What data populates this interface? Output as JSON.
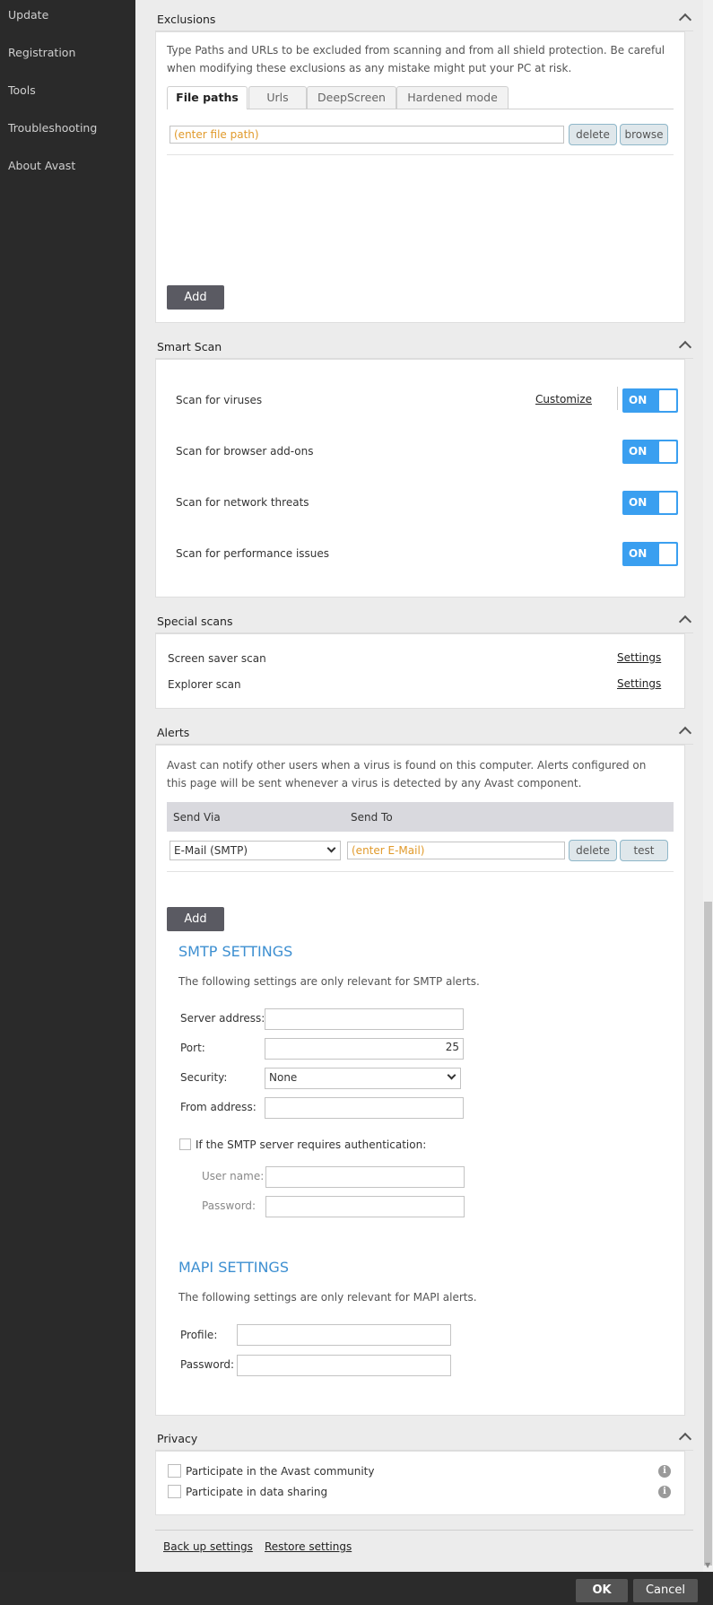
{
  "sidebar": {
    "items": [
      {
        "label": "Update"
      },
      {
        "label": "Registration"
      },
      {
        "label": "Tools"
      },
      {
        "label": "Troubleshooting"
      },
      {
        "label": "About Avast"
      }
    ]
  },
  "exclusions": {
    "title": "Exclusions",
    "description": "Type Paths and URLs to be excluded from scanning and from all shield protection. Be careful when modifying these exclusions as any mistake might put your PC at risk.",
    "tabs": [
      {
        "label": "File paths"
      },
      {
        "label": "Urls"
      },
      {
        "label": "DeepScreen"
      },
      {
        "label": "Hardened mode"
      }
    ],
    "path_placeholder": "(enter file path)",
    "delete_label": "delete",
    "browse_label": "browse",
    "add_label": "Add"
  },
  "smart_scan": {
    "title": "Smart Scan",
    "customize_label": "Customize",
    "items": [
      {
        "label": "Scan for viruses",
        "state": "ON"
      },
      {
        "label": "Scan for browser add-ons",
        "state": "ON"
      },
      {
        "label": "Scan for network threats",
        "state": "ON"
      },
      {
        "label": "Scan for performance issues",
        "state": "ON"
      }
    ]
  },
  "special_scans": {
    "title": "Special scans",
    "items": [
      {
        "label": "Screen saver scan",
        "link": "Settings"
      },
      {
        "label": "Explorer scan",
        "link": "Settings"
      }
    ]
  },
  "alerts": {
    "title": "Alerts",
    "description": "Avast can notify other users when a virus is found on this computer. Alerts configured on this page will be sent whenever a virus is detected by any Avast component.",
    "col_send_via": "Send Via",
    "col_send_to": "Send To",
    "send_via_value": "E-Mail (SMTP)",
    "send_to_placeholder": "(enter E-Mail)",
    "delete_label": "delete",
    "test_label": "test",
    "add_label": "Add",
    "smtp": {
      "title": "SMTP SETTINGS",
      "description": "The following settings are only relevant for SMTP alerts.",
      "server_label": "Server address:",
      "port_label": "Port:",
      "port_value": "25",
      "security_label": "Security:",
      "security_value": "None",
      "from_label": "From address:",
      "auth_label": "If the SMTP server requires authentication:",
      "username_label": "User name:",
      "password_label": "Password:"
    },
    "mapi": {
      "title": "MAPI SETTINGS",
      "description": "The following settings are only relevant for MAPI alerts.",
      "profile_label": "Profile:",
      "password_label": "Password:"
    }
  },
  "privacy": {
    "title": "Privacy",
    "items": [
      {
        "label": "Participate in the Avast community"
      },
      {
        "label": "Participate in data sharing"
      }
    ]
  },
  "bottom_links": {
    "backup": "Back up settings",
    "restore": "Restore settings"
  },
  "footer": {
    "ok": "OK",
    "cancel": "Cancel"
  },
  "colors": {
    "accent": "#3a9ff0",
    "placeholder": "#e19a2b",
    "section_title_blue": "#3d8fd1"
  }
}
